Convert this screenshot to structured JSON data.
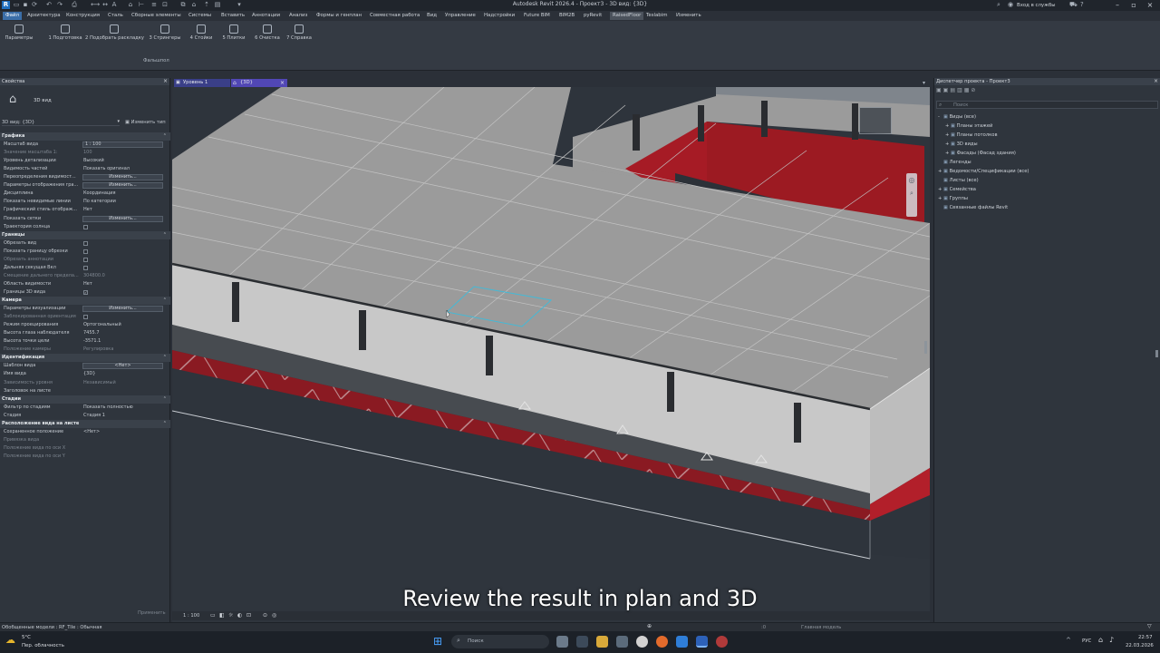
{
  "window": {
    "title": "Autodesk Revit 2026.4 - Проект3 - 3D вид: {3D}",
    "sign_in": "Вход в службы"
  },
  "menu": [
    {
      "label": "Файл",
      "active": true
    },
    {
      "label": "Архитектура"
    },
    {
      "label": "Конструкция"
    },
    {
      "label": "Сталь"
    },
    {
      "label": "Сборные элементы"
    },
    {
      "label": "Системы"
    },
    {
      "label": "Вставить"
    },
    {
      "label": "Аннотации"
    },
    {
      "label": "Анализ"
    },
    {
      "label": "Формы и генплан"
    },
    {
      "label": "Совместная работа"
    },
    {
      "label": "Вид"
    },
    {
      "label": "Управление"
    },
    {
      "label": "Надстройки"
    },
    {
      "label": "Future BIM"
    },
    {
      "label": "BIM2B"
    },
    {
      "label": "pyRevit"
    },
    {
      "label": "RaisedFloor",
      "hl": true
    },
    {
      "label": "Teslabim"
    },
    {
      "label": "Изменить"
    }
  ],
  "ribbon": {
    "buttons": [
      {
        "label": "Параметры",
        "icon": "gear-icon"
      },
      {
        "label": "1 Подготовка",
        "icon": "document-icon"
      },
      {
        "label": "2 Подобрать раскладку",
        "icon": "search-grid-icon"
      },
      {
        "label": "3 Стрингеры",
        "icon": "grid-icon"
      },
      {
        "label": "4 Стойки",
        "icon": "columns-icon"
      },
      {
        "label": "5 Плитки",
        "icon": "tiles-icon"
      },
      {
        "label": "6 Очистка",
        "icon": "trash-icon"
      },
      {
        "label": "7 Справка",
        "icon": "help-icon"
      }
    ],
    "panel_name": "Фальшпол"
  },
  "properties": {
    "title": "Свойства",
    "type_name": "3D вид",
    "selector": "3D вид: {3D}",
    "edit_type": "Изменить тип",
    "apply": "Применить",
    "rows": [
      {
        "sec": "Графика"
      },
      {
        "k": "Масштаб вида",
        "v": "1 : 100",
        "field": true
      },
      {
        "k": "Значение масштаба    1:",
        "v": "100",
        "dim": true
      },
      {
        "k": "Уровень детализации",
        "v": "Высокий"
      },
      {
        "k": "Видимость частей",
        "v": "Показать оригинал"
      },
      {
        "k": "Переопределения видимост...",
        "v": "Изменить...",
        "btn": true
      },
      {
        "k": "Параметры отображения гра...",
        "v": "Изменить...",
        "btn": true
      },
      {
        "k": "Дисциплина",
        "v": "Координация"
      },
      {
        "k": "Показать невидимые линии",
        "v": "По категории"
      },
      {
        "k": "Графический стиль отображ...",
        "v": "Нет"
      },
      {
        "k": "Показать сетки",
        "v": "Изменить...",
        "btn": true
      },
      {
        "k": "Траектория солнца",
        "chk": true
      },
      {
        "sec": "Границы"
      },
      {
        "k": "Обрезать вид",
        "chk": true
      },
      {
        "k": "Показать границу обрезки",
        "chk": true
      },
      {
        "k": "Обрезать аннотации",
        "chk": true,
        "dim": true
      },
      {
        "k": "Дальняя секущая Вкл",
        "chk": true
      },
      {
        "k": "Смещение дальнего предела...",
        "v": "304800.0",
        "dim": true
      },
      {
        "k": "Область видимости",
        "v": "Нет"
      },
      {
        "k": "Границы 3D вида",
        "chk": true,
        "checked": true
      },
      {
        "sec": "Камера"
      },
      {
        "k": "Параметры визуализации",
        "v": "Изменить...",
        "btn": true
      },
      {
        "k": "Заблокированная ориентация",
        "chk": true,
        "dim": true
      },
      {
        "k": "Режим проецирования",
        "v": "Ортогональный"
      },
      {
        "k": "Высота глаза наблюдателя",
        "v": "7455.7"
      },
      {
        "k": "Высота точки цели",
        "v": "-3571.1"
      },
      {
        "k": "Положение камеры",
        "v": "Регулировка",
        "dim": true
      },
      {
        "sec": "Идентификация"
      },
      {
        "k": "Шаблон вида",
        "v": "<Нет>",
        "btn": true
      },
      {
        "k": "Имя вида",
        "v": "{3D}"
      },
      {
        "k": "Зависимость уровня",
        "v": "Независимый",
        "dim": true
      },
      {
        "k": "Заголовок на листе",
        "v": ""
      },
      {
        "sec": "Стадии"
      },
      {
        "k": "Фильтр по стадиям",
        "v": "Показать полностью"
      },
      {
        "k": "Стадия",
        "v": "Стадия 1"
      },
      {
        "sec": "Расположение вида на листе"
      },
      {
        "k": "Сохраненное положение",
        "v": "<Нет>"
      },
      {
        "k": "Привязка вида",
        "v": "",
        "dim": true
      },
      {
        "k": "Положение вида по оси X",
        "v": "",
        "dim": true
      },
      {
        "k": "Положение вида по оси Y",
        "v": "",
        "dim": true
      }
    ]
  },
  "tabs": [
    {
      "label": "Уровень 1"
    },
    {
      "label": "{3D}",
      "active": true
    }
  ],
  "browser": {
    "title": "Диспетчер проекта - Проект3",
    "search_placeholder": "Поиск",
    "items": [
      {
        "label": "Виды (все)",
        "level": 0,
        "exp": "-"
      },
      {
        "label": "Планы этажей",
        "level": 1,
        "exp": "+"
      },
      {
        "label": "Планы потолков",
        "level": 1,
        "exp": "+"
      },
      {
        "label": "3D виды",
        "level": 1,
        "exp": "+"
      },
      {
        "label": "Фасады (Фасад здания)",
        "level": 1,
        "exp": "+"
      },
      {
        "label": "Легенды",
        "level": 0,
        "exp": ""
      },
      {
        "label": "Ведомости/Спецификации (все)",
        "level": 0,
        "exp": "+"
      },
      {
        "label": "Листы (все)",
        "level": 0,
        "exp": ""
      },
      {
        "label": "Семейства",
        "level": 0,
        "exp": "+"
      },
      {
        "label": "Группы",
        "level": 0,
        "exp": "+"
      },
      {
        "label": "Связанные файлы Revit",
        "level": 0,
        "exp": ""
      }
    ]
  },
  "view_controls": {
    "scale": "1 : 100"
  },
  "status": {
    "left": "Обобщенные модели : RF_Tile : Обычная",
    "right": "Главная модель",
    "coord": ":0"
  },
  "taskbar": {
    "weather_temp": "5°C",
    "weather_desc": "Пер. облачность",
    "search": "Поиск",
    "lang": "РУС",
    "time": "22:57",
    "date": "22.03.2026"
  },
  "caption": "Review the result in plan and 3D",
  "colors": {
    "accent": "#3b6ea8",
    "red_band": "#8a1a22",
    "slab": "#9b9b9b"
  }
}
